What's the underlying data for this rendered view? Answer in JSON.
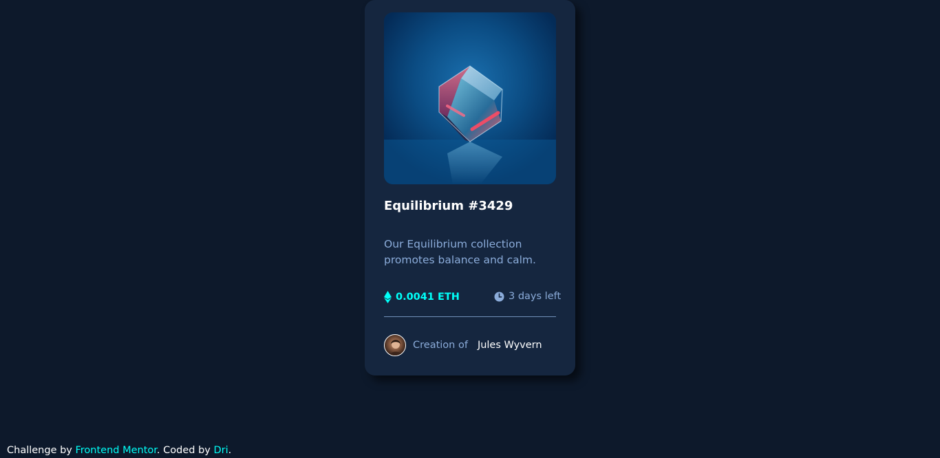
{
  "card": {
    "image_alt": "equilibrium cube",
    "title": "Equilibrium #3429",
    "description": "Our Equilibrium collection promotes balance and calm.",
    "price": "0.0041 ETH",
    "time_left": "3 days left",
    "creator_prefix": "Creation of",
    "creator_name": "Jules Wyvern",
    "icons": {
      "price": "ethereum-icon",
      "time": "clock-icon"
    }
  },
  "attribution": {
    "prefix": "Challenge by",
    "link1": "Frontend Mentor",
    "middle": ". Coded by",
    "link2": "Dri",
    "suffix": "."
  },
  "colors": {
    "page_background": "#0d192b",
    "card_background": "#15263f",
    "accent_cyan": "#00fff8",
    "soft_blue": "#8bacda",
    "white": "#ffffff"
  }
}
